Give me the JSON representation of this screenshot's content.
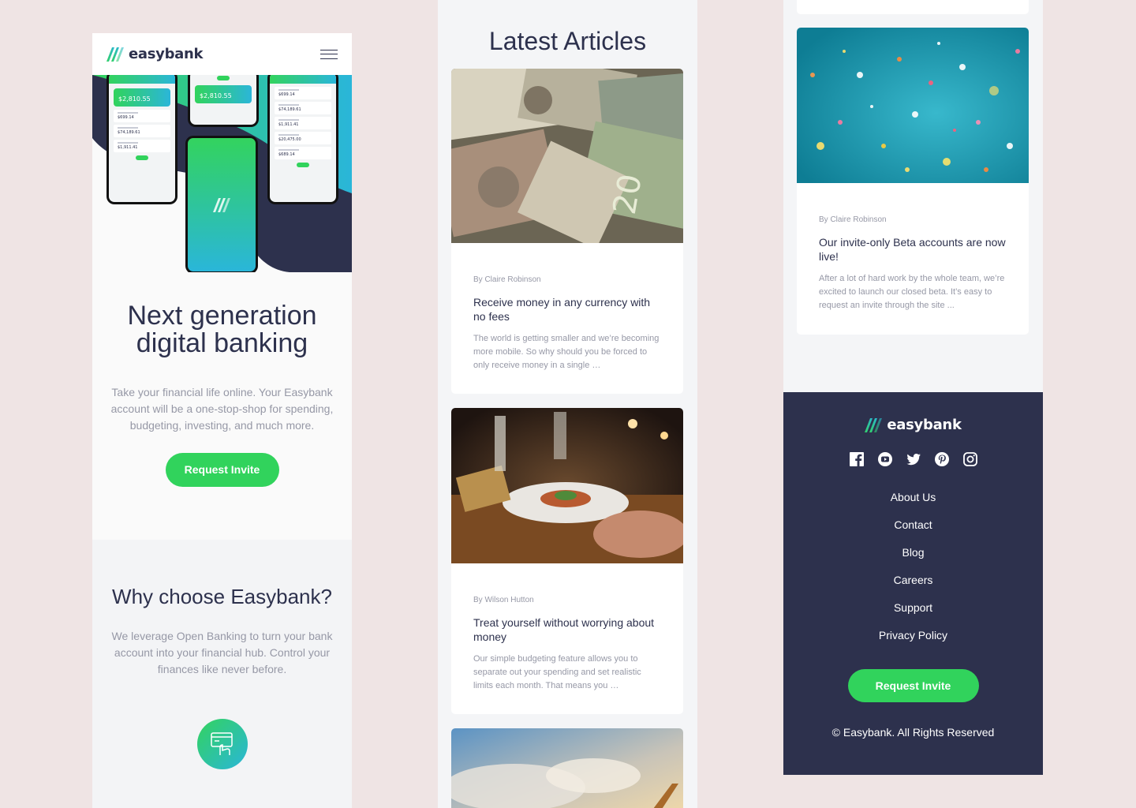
{
  "brand": {
    "name": "easybank",
    "accent": "#31d35c",
    "accent2": "#2ab6d9",
    "navy": "#2d314d"
  },
  "hero": {
    "title": "Next generation digital banking",
    "text": "Take your financial life online. Your Easybank account will be a one-stop-shop for spending, budgeting, investing, and much more.",
    "cta": "Request Invite",
    "phone_balances": [
      "$2,810.55",
      "$2,810.55"
    ],
    "phone_rows_left": [
      "$699.14",
      "$74,189.61",
      "$1,911.41"
    ],
    "phone_rows_right": [
      "$699.14",
      "$74,189.61",
      "$1,911.41",
      "$20,475.00",
      "$689.14"
    ]
  },
  "why": {
    "title": "Why choose Easybank?",
    "text": "We leverage Open Banking to turn your bank account into your financial hub. Control your finances like never before.",
    "icon": "online-banking-icon"
  },
  "articles": {
    "title": "Latest Articles",
    "items": [
      {
        "author": "By Claire Robinson",
        "title": "Receive money in any currency with no fees",
        "text": "The world is getting smaller and we’re becoming more mobile. So why should you be forced to only receive money in a single …",
        "image": "currency-photo"
      },
      {
        "author": "By Wilson Hutton",
        "title": "Treat yourself without worrying about money",
        "text": "Our simple budgeting feature allows you to separate out your spending and set realistic limits each month. That means you …",
        "image": "restaurant-photo"
      },
      {
        "image": "sky-plane-photo"
      }
    ]
  },
  "beta_card": {
    "author": "By Claire Robinson",
    "title": "Our invite-only Beta accounts are now live!",
    "text": "After a lot of hard work by the whole team, we’re excited to launch our closed beta. It’s easy to request an invite through the site ...",
    "image": "confetti-photo"
  },
  "footer": {
    "socials": [
      "facebook-icon",
      "youtube-icon",
      "twitter-icon",
      "pinterest-icon",
      "instagram-icon"
    ],
    "links": [
      "About Us",
      "Contact",
      "Blog",
      "Careers",
      "Support",
      "Privacy Policy"
    ],
    "cta": "Request Invite",
    "copyright": "© Easybank. All Rights Reserved"
  }
}
